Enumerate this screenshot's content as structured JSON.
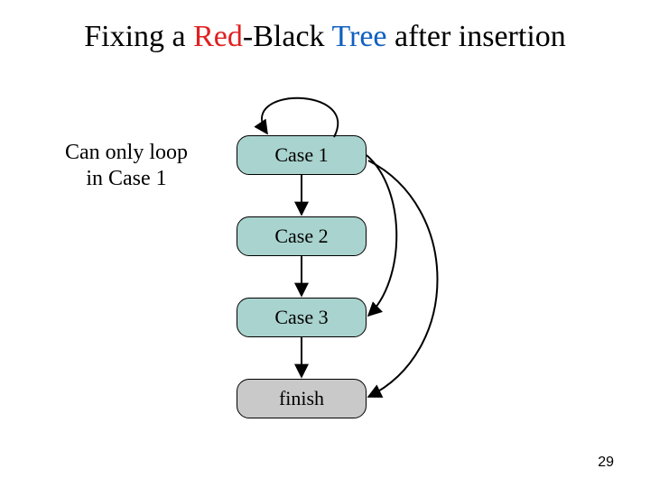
{
  "title": {
    "prefix": "Fixing a ",
    "red": "Red",
    "hyphen": "-",
    "black": "Black",
    "space": " ",
    "tree": "Tree",
    "suffix": " after insertion"
  },
  "sidenote": {
    "line1": "Can only loop",
    "line2": "in Case 1"
  },
  "nodes": {
    "case1": "Case 1",
    "case2": "Case 2",
    "case3": "Case 3",
    "finish": "finish"
  },
  "slide_number": "29",
  "colors": {
    "red": "#e02020",
    "blue": "#1060c0",
    "teal": "#a9d3ce",
    "gray": "#c9c9c9"
  },
  "chart_data": {
    "type": "diagram",
    "title": "Fixing a Red-Black Tree after insertion",
    "nodes": [
      {
        "id": "case1",
        "label": "Case 1",
        "fill": "teal"
      },
      {
        "id": "case2",
        "label": "Case 2",
        "fill": "teal"
      },
      {
        "id": "case3",
        "label": "Case 3",
        "fill": "teal"
      },
      {
        "id": "finish",
        "label": "finish",
        "fill": "gray"
      }
    ],
    "edges": [
      {
        "from": "case1",
        "to": "case1",
        "kind": "self-loop"
      },
      {
        "from": "case1",
        "to": "case2",
        "kind": "straight"
      },
      {
        "from": "case2",
        "to": "case3",
        "kind": "straight"
      },
      {
        "from": "case3",
        "to": "finish",
        "kind": "straight"
      },
      {
        "from": "case1",
        "to": "case3",
        "kind": "curve-right"
      },
      {
        "from": "case1",
        "to": "finish",
        "kind": "curve-right"
      }
    ],
    "annotations": [
      {
        "text": "Can only loop in Case 1",
        "target": "case1"
      }
    ]
  }
}
